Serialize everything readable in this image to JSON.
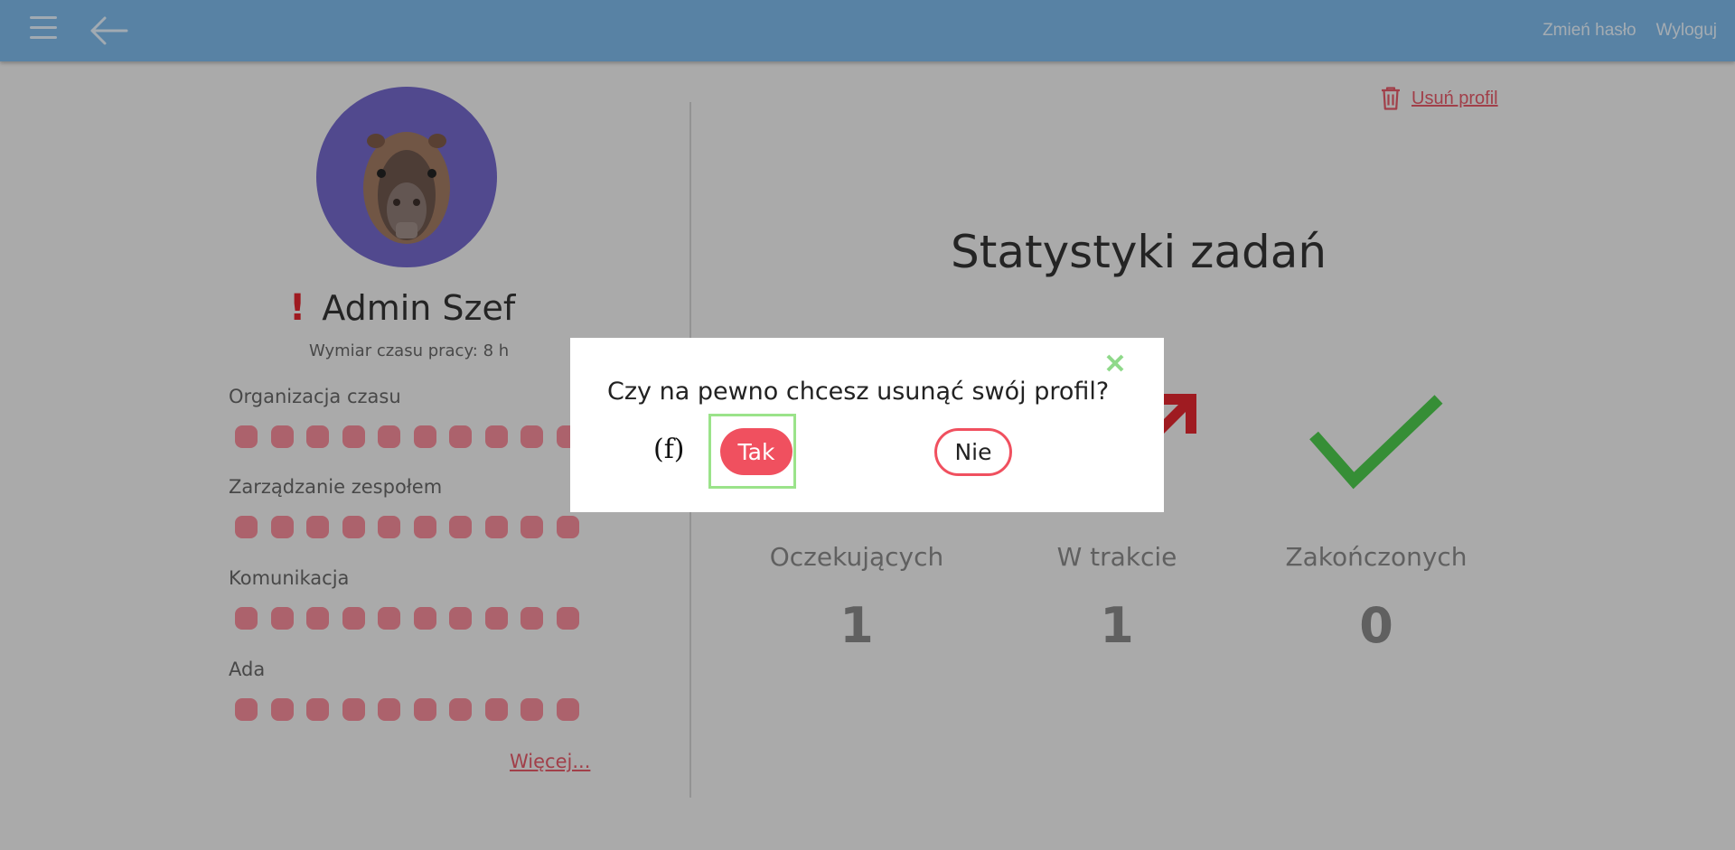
{
  "topbar": {
    "menu_icon": "hamburger-icon",
    "back_icon": "arrow-left-icon",
    "change_password": "Zmień hasło",
    "logout": "Wyloguj"
  },
  "profile": {
    "avatar_icon": "capybara-avatar",
    "alert_mark": "!",
    "name": "Admin Szef",
    "work_time": "Wymiar czasu pracy: 8 h",
    "skills": [
      {
        "label": "Organizacja czasu",
        "level": 10,
        "max": 10
      },
      {
        "label": "Zarządzanie zespołem",
        "level": 10,
        "max": 10
      },
      {
        "label": "Komunikacja",
        "level": 10,
        "max": 10
      },
      {
        "label": "Ada",
        "level": 10,
        "max": 10
      }
    ],
    "more_link": "Więcej..."
  },
  "delete_profile": {
    "icon": "trash-icon",
    "label": "Usuń profil"
  },
  "stats": {
    "title": "Statystyki zadań",
    "columns": [
      {
        "label": "Oczekujących",
        "value": "1",
        "icon": "hourglass-icon"
      },
      {
        "label": "W trakcie",
        "value": "1",
        "icon": "arrow-up-right-icon"
      },
      {
        "label": "Zakończonych",
        "value": "0",
        "icon": "checkmark-icon"
      }
    ]
  },
  "dialog": {
    "question": "Czy na pewno chcesz usunąć swój profil?",
    "close_icon": "close-icon",
    "marker": "(f)",
    "yes_label": "Tak",
    "no_label": "Nie"
  },
  "colors": {
    "topbar": "#7db8e8",
    "accent_red": "#f0505f",
    "skill_dot": "#f38b98",
    "check_green": "#4cc94c",
    "avatar_bg": "#7367c8",
    "focus_frame": "#9be38a"
  }
}
